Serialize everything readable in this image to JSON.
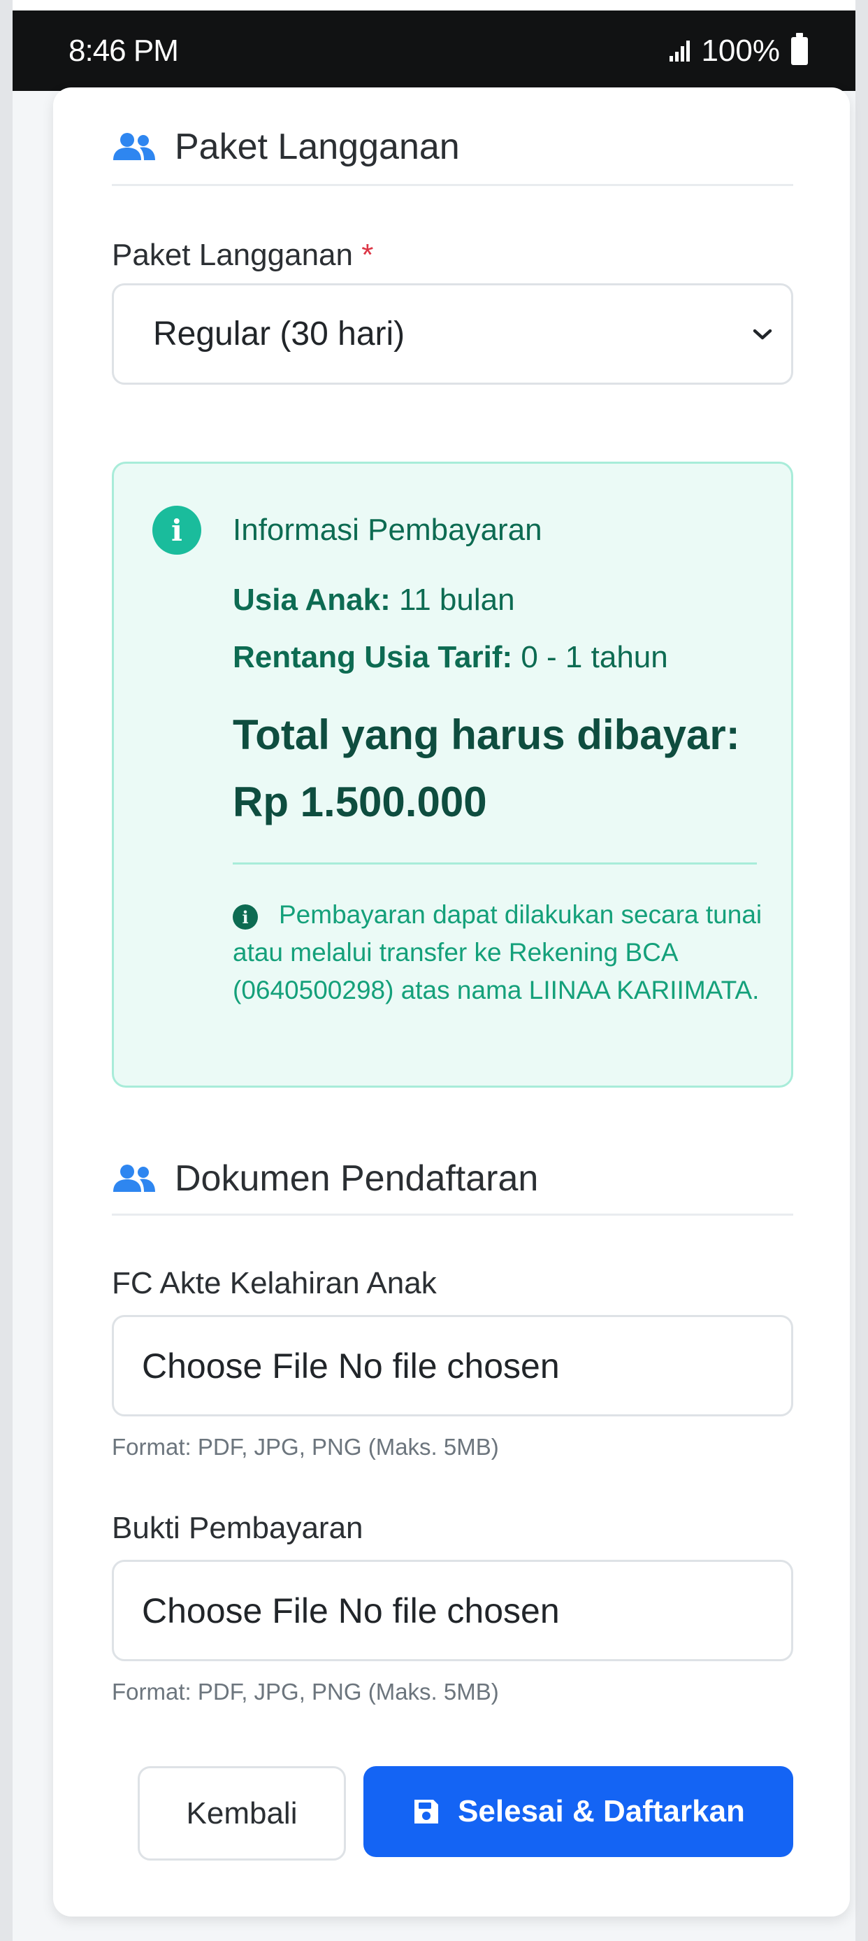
{
  "status_bar": {
    "time": "8:46 PM",
    "battery": "100%"
  },
  "subscription": {
    "section_title": "Paket Langganan",
    "field_label": "Paket Langganan",
    "required_mark": "*",
    "selected": "Regular (30 hari)"
  },
  "payment_info": {
    "title": "Informasi Pembayaran",
    "age_label": "Usia Anak:",
    "age_value": "11 bulan",
    "range_label": "Rentang Usia Tarif:",
    "range_value": "0 - 1 tahun",
    "total_label": "Total yang harus dibayar:",
    "total_value": "Rp 1.500.000",
    "note": "Pembayaran dapat dilakukan secara tunai atau melalui transfer ke Rekening BCA (0640500298) atas nama LIINAA KARIIMATA."
  },
  "documents": {
    "section_title": "Dokumen Pendaftaran",
    "birth_cert_label": "FC Akte Kelahiran Anak",
    "birth_cert_button": "Choose File",
    "birth_cert_status": "No file chosen",
    "birth_cert_help": "Format: PDF, JPG, PNG (Maks. 5MB)",
    "payment_proof_label": "Bukti Pembayaran",
    "payment_proof_button": "Choose File",
    "payment_proof_status": "No file chosen",
    "payment_proof_help": "Format: PDF, JPG, PNG (Maks. 5MB)"
  },
  "actions": {
    "back_label": "Kembali",
    "submit_label": "Selesai & Daftarkan"
  },
  "colors": {
    "primary": "#1464f4",
    "info_bg": "#ebfaf6",
    "info_border": "#a8ecd9",
    "info_text": "#0d6b52",
    "required": "#dc3545",
    "icon_blue": "#2e86f0"
  },
  "icons": {
    "section": "users-icon",
    "info": "info-circle-icon",
    "submit": "floppy-disk-icon",
    "select": "chevron-down-icon"
  }
}
